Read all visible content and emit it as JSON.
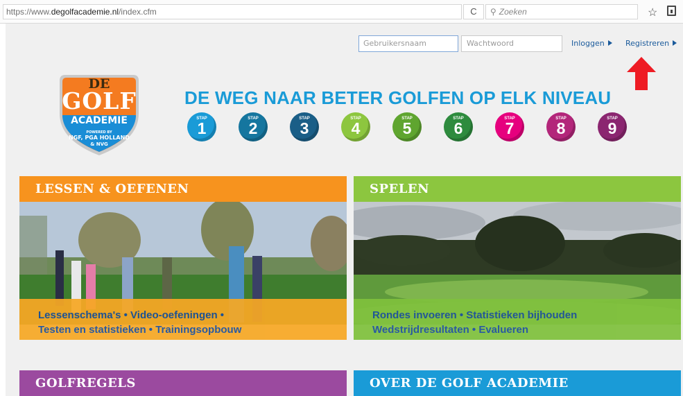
{
  "browser": {
    "url_prefix": "https://www.",
    "url_host": "degolfacademie.nl",
    "url_path": "/index.cfm",
    "reload_glyph": "C",
    "search_placeholder": "Zoeken",
    "icons": [
      "reload-icon",
      "search-icon",
      "bookmark-star-icon",
      "reading-list-icon"
    ]
  },
  "login": {
    "username_placeholder": "Gebruikersnaam",
    "password_placeholder": "Wachtwoord",
    "login_label": "Inloggen",
    "register_label": "Registreren"
  },
  "annotation": {
    "icon": "red-arrow-icon",
    "color": "#ee1c24"
  },
  "logo": {
    "line1": "DE",
    "line2": "GOLF",
    "line3": "ACADEMIE",
    "line4": "POWERED BY",
    "line5": "NGF, PGA HOLLAND",
    "line6": "& NVG",
    "color_orange": "#f47b20",
    "color_blue": "#1a8dd6"
  },
  "tagline": "DE WEG NAAR BETER GOLFEN OP ELK NIVEAU",
  "steps": [
    {
      "label": "STAP",
      "number": "1",
      "color": "#1a9bd7"
    },
    {
      "label": "STAP",
      "number": "2",
      "color": "#15769f"
    },
    {
      "label": "STAP",
      "number": "3",
      "color": "#1a5e87"
    },
    {
      "label": "STAP",
      "number": "4",
      "color": "#8dc63f"
    },
    {
      "label": "STAP",
      "number": "5",
      "color": "#5fa52f"
    },
    {
      "label": "STAP",
      "number": "6",
      "color": "#2e8b3e"
    },
    {
      "label": "STAP",
      "number": "7",
      "color": "#e6007e"
    },
    {
      "label": "STAP",
      "number": "8",
      "color": "#b3267a"
    },
    {
      "label": "STAP",
      "number": "9",
      "color": "#8b2670"
    }
  ],
  "tiles": [
    {
      "title": "LESSEN & OEFENEN",
      "head_color": "#f7931e",
      "band_color": "#f7a825",
      "line1": "Lessenschema's • Video-oefeningen •",
      "line2": "Testen en statistieken • Trainingsopbouw"
    },
    {
      "title": "SPELEN",
      "head_color": "#8cc63f",
      "band_color": "#80c13d",
      "line1": "Rondes invoeren • Statistieken bijhouden",
      "line2": "Wedstrijdresultaten • Evalueren"
    },
    {
      "title": "GOLFREGELS",
      "head_color": "#9b4a9f"
    },
    {
      "title": "OVER DE GOLF ACADEMIE",
      "head_color": "#1a9bd7"
    }
  ]
}
